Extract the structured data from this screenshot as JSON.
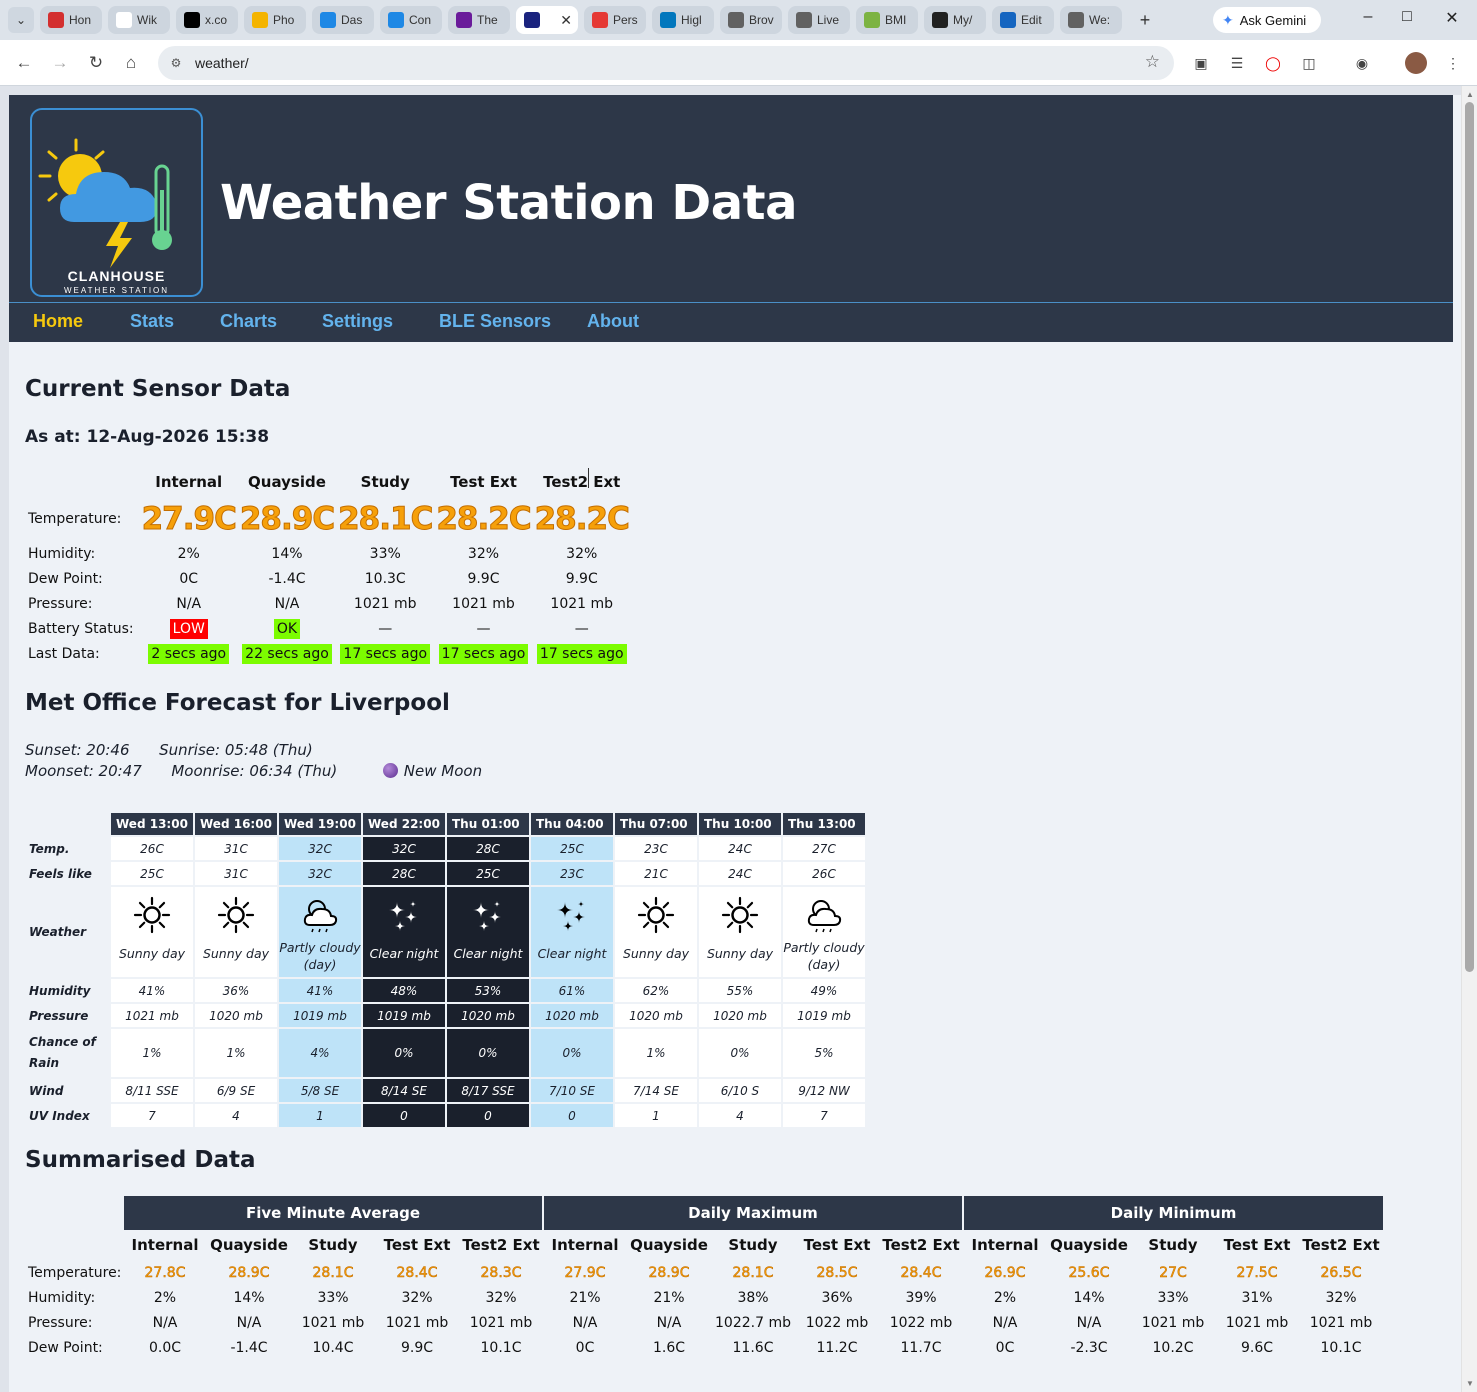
{
  "browser": {
    "tabs": [
      {
        "label": "Hon",
        "fav_color": "#d32f2f"
      },
      {
        "label": "Wik",
        "fav_color": "#ffffff"
      },
      {
        "label": "x.co",
        "fav_color": "#000000"
      },
      {
        "label": "Pho",
        "fav_color": "#f4b400"
      },
      {
        "label": "Das",
        "fav_color": "#1e88e5"
      },
      {
        "label": "Con",
        "fav_color": "#1e88e5"
      },
      {
        "label": "The",
        "fav_color": "#6a1b9a"
      },
      {
        "label": "",
        "fav_color": "#1a237e",
        "active": true
      },
      {
        "label": "Pers",
        "fav_color": "#e53935"
      },
      {
        "label": "Higl",
        "fav_color": "#0277bd"
      },
      {
        "label": "Brov",
        "fav_color": "#616161"
      },
      {
        "label": "Live",
        "fav_color": "#616161"
      },
      {
        "label": "BMI",
        "fav_color": "#7cb342"
      },
      {
        "label": "My/",
        "fav_color": "#212121"
      },
      {
        "label": "Edit",
        "fav_color": "#1565c0"
      },
      {
        "label": "We:",
        "fav_color": "#616161"
      }
    ],
    "ask_gemini": "Ask Gemini",
    "url": "weather/"
  },
  "site": {
    "title": "Weather Station Data",
    "logo_name": "CLANHOUSE",
    "logo_sub": "WEATHER STATION",
    "nav": [
      "Home",
      "Stats",
      "Charts",
      "Settings",
      "BLE Sensors",
      "About"
    ]
  },
  "current": {
    "heading": "Current Sensor Data",
    "as_at": "As at: 12-Aug-2026 15:38",
    "sensors": [
      "Internal",
      "Quayside",
      "Study",
      "Test Ext",
      "Test2 Ext"
    ],
    "rows": {
      "temperature_label": "Temperature:",
      "temperature": [
        "27.9C",
        "28.9C",
        "28.1C",
        "28.2C",
        "28.2C"
      ],
      "humidity_label": "Humidity:",
      "humidity": [
        "2%",
        "14%",
        "33%",
        "32%",
        "32%"
      ],
      "dewpoint_label": "Dew Point:",
      "dewpoint": [
        "0C",
        "-1.4C",
        "10.3C",
        "9.9C",
        "9.9C"
      ],
      "pressure_label": "Pressure:",
      "pressure": [
        "N/A",
        "N/A",
        "1021 mb",
        "1021 mb",
        "1021 mb"
      ],
      "battery_label": "Battery Status:",
      "battery": [
        "LOW",
        "OK",
        "—",
        "—",
        "—"
      ],
      "lastdata_label": "Last Data:",
      "lastdata": [
        "2 secs ago",
        "22 secs ago",
        "17 secs ago",
        "17 secs ago",
        "17 secs ago"
      ]
    },
    "colors": {
      "temp": "#f6a00a",
      "low": "#ff0000",
      "ok": "#7cfc00"
    }
  },
  "forecast": {
    "heading": "Met Office Forecast for Liverpool",
    "sunset": "Sunset: 20:46",
    "sunrise": "Sunrise: 05:48 (Thu)",
    "moonset": "Moonset: 20:47",
    "moonrise": "Moonrise: 06:34 (Thu)",
    "moon_phase": "New Moon",
    "row_labels": {
      "temp": "Temp.",
      "feels": "Feels like",
      "weather": "Weather",
      "humidity": "Humidity",
      "pressure": "Pressure",
      "rain": "Chance of Rain",
      "wind": "Wind",
      "uv": "UV Index"
    },
    "columns": [
      {
        "time": "Wed 13:00",
        "style": "day",
        "temp": "26C",
        "feels": "25C",
        "icon": "sun-icon",
        "weather": "Sunny day",
        "humidity": "41%",
        "pressure": "1021 mb",
        "rain": "1%",
        "wind": "8/11 SSE",
        "uv": "7"
      },
      {
        "time": "Wed 16:00",
        "style": "day",
        "temp": "31C",
        "feels": "31C",
        "icon": "sun-icon",
        "weather": "Sunny day",
        "humidity": "36%",
        "pressure": "1020 mb",
        "rain": "1%",
        "wind": "6/9 SE",
        "uv": "4"
      },
      {
        "time": "Wed 19:00",
        "style": "light",
        "temp": "32C",
        "feels": "32C",
        "icon": "partly-cloudy-icon",
        "weather": "Partly cloudy (day)",
        "humidity": "41%",
        "pressure": "1019 mb",
        "rain": "4%",
        "wind": "5/8 SE",
        "uv": "1"
      },
      {
        "time": "Wed 22:00",
        "style": "dark",
        "temp": "32C",
        "feels": "28C",
        "icon": "stars-icon",
        "weather": "Clear night",
        "humidity": "48%",
        "pressure": "1019 mb",
        "rain": "0%",
        "wind": "8/14 SE",
        "uv": "0"
      },
      {
        "time": "Thu 01:00",
        "style": "dark",
        "temp": "28C",
        "feels": "25C",
        "icon": "stars-icon",
        "weather": "Clear night",
        "humidity": "53%",
        "pressure": "1020 mb",
        "rain": "0%",
        "wind": "8/17 SSE",
        "uv": "0"
      },
      {
        "time": "Thu 04:00",
        "style": "light",
        "temp": "25C",
        "feels": "23C",
        "icon": "stars-icon",
        "weather": "Clear night",
        "humidity": "61%",
        "pressure": "1020 mb",
        "rain": "0%",
        "wind": "7/10 SE",
        "uv": "0"
      },
      {
        "time": "Thu 07:00",
        "style": "day",
        "temp": "23C",
        "feels": "21C",
        "icon": "sun-icon",
        "weather": "Sunny day",
        "humidity": "62%",
        "pressure": "1020 mb",
        "rain": "1%",
        "wind": "7/14 SE",
        "uv": "1"
      },
      {
        "time": "Thu 10:00",
        "style": "day",
        "temp": "24C",
        "feels": "24C",
        "icon": "sun-icon",
        "weather": "Sunny day",
        "humidity": "55%",
        "pressure": "1020 mb",
        "rain": "0%",
        "wind": "6/10 S",
        "uv": "4"
      },
      {
        "time": "Thu 13:00",
        "style": "day",
        "temp": "27C",
        "feels": "26C",
        "icon": "partly-cloudy-icon",
        "weather": "Partly cloudy (day)",
        "humidity": "49%",
        "pressure": "1019 mb",
        "rain": "5%",
        "wind": "9/12 NW",
        "uv": "7"
      }
    ]
  },
  "summary": {
    "heading": "Summarised Data",
    "groups": [
      "Five Minute Average",
      "Daily Maximum",
      "Daily Minimum"
    ],
    "sensors": [
      "Internal",
      "Quayside",
      "Study",
      "Test Ext",
      "Test2 Ext"
    ],
    "row_labels": [
      "Temperature:",
      "Humidity:",
      "Pressure:",
      "Dew Point:"
    ],
    "rows": [
      [
        "27.8C",
        "28.9C",
        "28.1C",
        "28.4C",
        "28.3C",
        "27.9C",
        "28.9C",
        "28.1C",
        "28.5C",
        "28.4C",
        "26.9C",
        "25.6C",
        "27C",
        "27.5C",
        "26.5C"
      ],
      [
        "2%",
        "14%",
        "33%",
        "32%",
        "32%",
        "21%",
        "21%",
        "38%",
        "36%",
        "39%",
        "2%",
        "14%",
        "33%",
        "31%",
        "32%"
      ],
      [
        "N/A",
        "N/A",
        "1021 mb",
        "1021 mb",
        "1021 mb",
        "N/A",
        "N/A",
        "1022.7 mb",
        "1022 mb",
        "1022 mb",
        "N/A",
        "N/A",
        "1021 mb",
        "1021 mb",
        "1021 mb"
      ],
      [
        "0.0C",
        "-1.4C",
        "10.4C",
        "9.9C",
        "10.1C",
        "0C",
        "1.6C",
        "11.6C",
        "11.2C",
        "11.7C",
        "0C",
        "-2.3C",
        "10.2C",
        "9.6C",
        "10.1C"
      ]
    ]
  }
}
